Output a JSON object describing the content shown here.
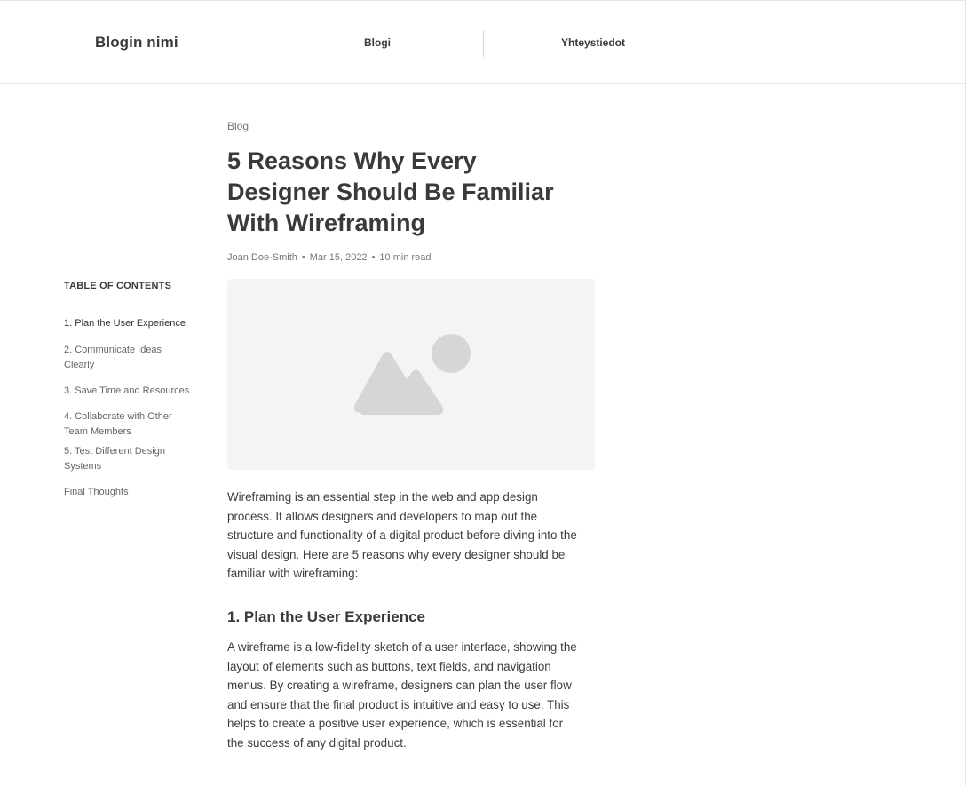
{
  "header": {
    "brand": "Blogin nimi",
    "nav": [
      {
        "label": "Blogi"
      },
      {
        "label": "Yhteystiedot"
      }
    ]
  },
  "toc": {
    "title": "TABLE OF CONTENTS",
    "items": [
      {
        "label": "1. Plan the User Experience",
        "active": true
      },
      {
        "label": "2. Communicate Ideas Clearly"
      },
      {
        "label": "3. Save Time and Resources"
      },
      {
        "label": "4. Collaborate with Other Team Members"
      },
      {
        "label": "5. Test Different Design Systems"
      },
      {
        "label": "Final Thoughts"
      }
    ]
  },
  "article": {
    "breadcrumb": "Blog",
    "title": "5 Reasons Why Every Designer Should Be Familiar With Wireframing",
    "author": "Joan Doe-Smith",
    "date": "Mar 15, 2022",
    "read_time": "10 min read",
    "meta_separator": "•",
    "hero_icon": "image-placeholder-icon",
    "intro": "Wireframing is an essential step in the web and app design process. It allows designers and developers to map out the structure and functionality of a digital product before diving into the visual design. Here are 5 reasons why every designer should be familiar with wireframing:",
    "sections": [
      {
        "heading": "1. Plan the User Experience",
        "body": "A wireframe is a low-fidelity sketch of a user interface, showing the layout of elements such as buttons, text fields, and navigation menus. By creating a wireframe, designers can plan the user flow and ensure that the final product is intuitive and easy to use. This helps to create a positive user experience, which is essential for the success of any digital product."
      }
    ]
  },
  "colors": {
    "text": "#3a3a3a",
    "muted": "#777777",
    "placeholder_bg": "#f4f4f4",
    "placeholder_icon": "#d6d6d6",
    "border": "#e8e8e8"
  }
}
